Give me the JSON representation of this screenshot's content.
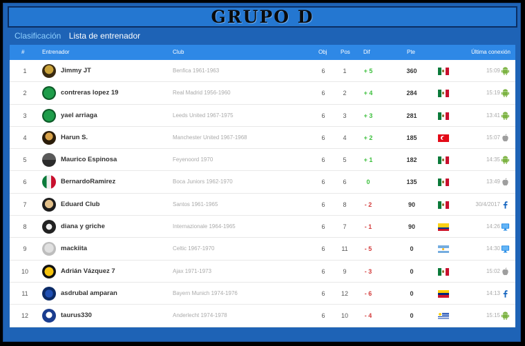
{
  "banner": {
    "title": "GRUPO D"
  },
  "tabs": [
    {
      "label": "Clasificación",
      "active": true
    },
    {
      "label": "Lista de entrenador",
      "active": false
    }
  ],
  "table": {
    "headers": {
      "num": "#",
      "coach": "Entrenador",
      "club": "Club",
      "obj": "Obj",
      "pos": "Pos",
      "dif": "Dif",
      "pte": "Pte",
      "last": "Última conexión"
    },
    "rows": [
      {
        "num": "1",
        "coach": "Jimmy JT",
        "club": "Benfica 1961-1963",
        "obj": "6",
        "pos": "1",
        "dif": "+ 5",
        "pte": "360",
        "flag": "mexico",
        "time": "15:09",
        "device": "android-icon"
      },
      {
        "num": "2",
        "coach": "contreras lopez 19",
        "club": "Real Madrid 1956-1960",
        "obj": "6",
        "pos": "2",
        "dif": "+ 4",
        "pte": "284",
        "flag": "mexico",
        "time": "15:19",
        "device": "android-icon"
      },
      {
        "num": "3",
        "coach": "yael arriaga",
        "club": "Leeds United 1967-1975",
        "obj": "6",
        "pos": "3",
        "dif": "+ 3",
        "pte": "281",
        "flag": "mexico",
        "time": "13:41",
        "device": "android-icon"
      },
      {
        "num": "4",
        "coach": "Harun S.",
        "club": "Manchester United 1967-1968",
        "obj": "6",
        "pos": "4",
        "dif": "+ 2",
        "pte": "185",
        "flag": "turkey",
        "time": "15:07",
        "device": "apple-icon"
      },
      {
        "num": "5",
        "coach": "Maurico Espinosa",
        "club": "Feyenoord 1970",
        "obj": "6",
        "pos": "5",
        "dif": "+ 1",
        "pte": "182",
        "flag": "mexico",
        "time": "14:35",
        "device": "android-icon"
      },
      {
        "num": "6",
        "coach": "BernardoRamirez",
        "club": "Boca Juniors 1962-1970",
        "obj": "6",
        "pos": "6",
        "dif": "0",
        "pte": "135",
        "flag": "mexico",
        "time": "13:49",
        "device": "apple-icon"
      },
      {
        "num": "7",
        "coach": "Eduard Club",
        "club": "Santos 1961-1965",
        "obj": "6",
        "pos": "8",
        "dif": "- 2",
        "pte": "90",
        "flag": "mexico",
        "time": "30/4/2017",
        "device": "facebook-icon"
      },
      {
        "num": "8",
        "coach": "diana y griche",
        "club": "Internazionale 1964-1965",
        "obj": "6",
        "pos": "7",
        "dif": "- 1",
        "pte": "90",
        "flag": "colombia",
        "time": "14:26",
        "device": "desktop-icon"
      },
      {
        "num": "9",
        "coach": "mackiita",
        "club": "Celtic 1967-1970",
        "obj": "6",
        "pos": "11",
        "dif": "- 5",
        "pte": "0",
        "flag": "argentina",
        "time": "14:30",
        "device": "desktop-icon"
      },
      {
        "num": "10",
        "coach": "Adrián Vázquez 7",
        "club": "Ajax 1971-1973",
        "obj": "6",
        "pos": "9",
        "dif": "- 3",
        "pte": "0",
        "flag": "mexico",
        "time": "15:02",
        "device": "apple-icon"
      },
      {
        "num": "11",
        "coach": "asdrubal amparan",
        "club": "Bayern Munich 1974-1976",
        "obj": "6",
        "pos": "12",
        "dif": "- 6",
        "pte": "0",
        "flag": "venezuela",
        "time": "14:13",
        "device": "facebook-icon"
      },
      {
        "num": "12",
        "coach": "taurus330",
        "club": "Anderlecht 1974-1978",
        "obj": "6",
        "pos": "10",
        "dif": "- 4",
        "pte": "0",
        "flag": "uruguay",
        "time": "15:15",
        "device": "android-icon"
      }
    ]
  },
  "colors": {
    "accent": "#2e88e6",
    "frame": "#1e63b6",
    "positive": "#3bbf3b",
    "negative": "#d33b3b"
  }
}
